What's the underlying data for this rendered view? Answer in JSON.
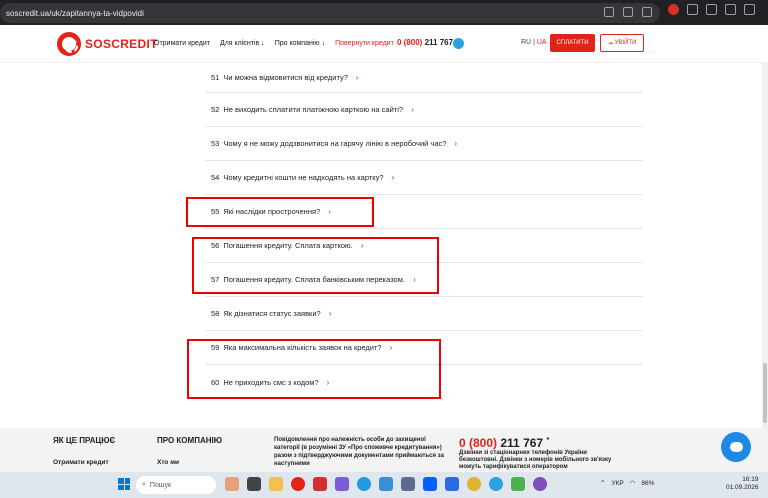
{
  "browser": {
    "url": "soscredit.ua/uk/zapitannya-ta-vidpovidi"
  },
  "header": {
    "logo_text": "SOSCREDIT",
    "nav": [
      {
        "label": "Отримати кредит"
      },
      {
        "label": "Для клієнтів ↓"
      },
      {
        "label": "Про компанію ↓"
      },
      {
        "label": "Повернути кредит"
      }
    ],
    "phone_prefix": "0 (800)",
    "phone_number": "211 767",
    "lang_ru": "RU",
    "lang_sep": "|",
    "lang_ua": "UA",
    "pay_button": "СПЛАТИТИ",
    "login_button": "УВІЙТИ"
  },
  "faq": {
    "items": [
      {
        "num": "51",
        "text": "Чи можна відмовитися від кредиту?"
      },
      {
        "num": "52",
        "text": "Не виходить сплатити платіжною карткою на сайті?"
      },
      {
        "num": "53",
        "text": "Чому я не можу додзвонитися на гарячу лінію в неробочий час?"
      },
      {
        "num": "54",
        "text": "Чому кредитні кошти не надходять на картку?"
      },
      {
        "num": "55",
        "text": "Які наслідки прострочення?"
      },
      {
        "num": "56",
        "text": "Погашення кредиту. Сплата карткою."
      },
      {
        "num": "57",
        "text": "Погашення кредиту. Сплата банківським переказом."
      },
      {
        "num": "58",
        "text": "Як дізнатися статус заявки?"
      },
      {
        "num": "59",
        "text": "Яка максимальна кількість заявок на кредит?"
      },
      {
        "num": "60",
        "text": "Не приходить смс з кодом?"
      }
    ]
  },
  "footer": {
    "col1_title": "ЯК ЦЕ ПРАЦЮЄ",
    "col1_link": "Отримати кредит",
    "col2_title": "ПРО КОМПАНІЮ",
    "col2_link": "Хто ми",
    "notice": "Повідомлення про належність особи до захищеної категорії (в розумінні ЗУ «Про споживче кредитування») разом з підтверджуючими документами приймаються за наступними",
    "phone_prefix": "0 (800)",
    "phone_number": "211 767",
    "phone_star": "*",
    "phone_note": "Дзвінки зі стаціонарних телефонів України безкоштовні. Дзвінки з номерів мобільного зв'язку можуть тарифікуватися оператором"
  },
  "taskbar": {
    "search": "Пошук",
    "lang": "УКР",
    "battery": "86%",
    "time": "16:19",
    "date": "01.09.2026"
  },
  "colors": {
    "brand": "#e2231a",
    "highlight": "#ee0000",
    "chat": "#1e88e5"
  }
}
